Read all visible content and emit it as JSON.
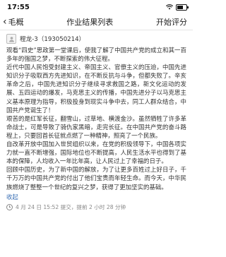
{
  "status": {
    "time": "17:55"
  },
  "nav": {
    "back_label": "毛概",
    "title": "作业结果列表",
    "action_label": "开始评分"
  },
  "post": {
    "author": "程龙-3（193050214）",
    "paragraphs": [
      "观看“四史”思政第一堂课后，使我了解了中国共产党的成立和其一百多年的强国之梦，不断探索的伟大征程。",
      "近代中国人民饱受封建主义、帝国主义、官僚主义的压迫，中国先进知识分子吸取西方先进知识，在不断反抗与斗争，但都失败了。辛亥革命之后，中国先进知识分子继续寻求救国之路，新文化运动的发展、五四运动的爆发，马克思主义的传播，中国先进分子以马克思主义基本原理为指导，积极投身到现实斗争中去，同工人群众结合，中国共产党诞生了！",
      "艰苦的是红军长征，翻雪山，过草地、横渡金沙。虽然牺牲了许多革命战士，可是导致了骑仇家黑暗，走完长征。在中国共产党的奋斗路程上，只要回首长征就点燃了一种精神，照亮了一个民族。",
      "自改革开放中国加入世贸组织以来，在党的积极领导下，中国各项实力就一直不断增强，国际地位也不断提高，人民生活水平也得到了基本的保障，人均收入一年比年高，让人民过上了幸福的日子。",
      "回顾中国历史，为了新中国的解放，为了让更多百姓过上好日子，千千万万的中国共产党的付出了他们宝贵而年轻生命。而今天，中华民族燃烧了整整一个世纪的复兴之梦，获得了更加坚实的基础。"
    ],
    "collapse_label": "收起",
    "meta": "4 月 24 日 15:52 提交，提前 2 小时 28 分钟"
  }
}
